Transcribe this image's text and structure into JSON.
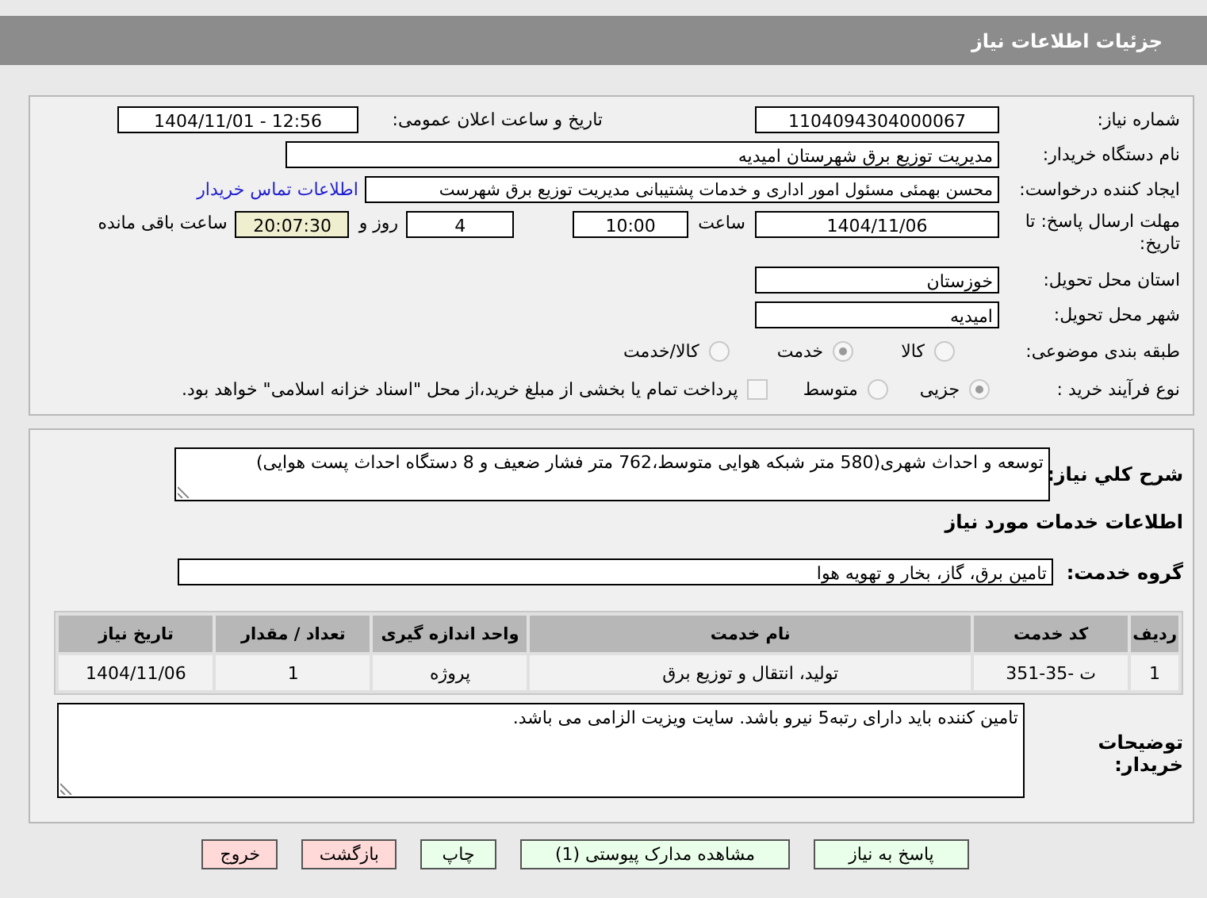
{
  "header": {
    "title": "جزئیات اطلاعات نیاز"
  },
  "need_number": {
    "label": "شماره نیاز:",
    "value": "1104094304000067"
  },
  "announce": {
    "label": "تاریخ و ساعت اعلان عمومی:",
    "value": "1404/11/01 - 12:56"
  },
  "buyer_name": {
    "label": "نام دستگاه خریدار:",
    "value": "مدیریت توزیع برق شهرستان امیدیه"
  },
  "creator": {
    "label": "ایجاد کننده درخواست:",
    "value": "محسن بهمئی مسئول امور اداری و خدمات پشتیبانی مدیریت توزیع برق شهرست",
    "link": "اطلاعات تماس خریدار"
  },
  "deadline": {
    "label": "مهلت ارسال پاسخ: تا تاریخ:",
    "date": "1404/11/06",
    "time_label": "ساعت",
    "time": "10:00",
    "days": "4",
    "days_label": "روز و",
    "remaining": "20:07:30",
    "remaining_label": "ساعت باقی مانده"
  },
  "province": {
    "label": "استان محل تحویل:",
    "value": "خوزستان"
  },
  "city": {
    "label": "شهر محل تحویل:",
    "value": "امیدیه"
  },
  "category": {
    "label": "طبقه بندی موضوعی:",
    "options": [
      {
        "label": "کالا",
        "selected": false
      },
      {
        "label": "خدمت",
        "selected": true
      },
      {
        "label": "کالا/خدمت",
        "selected": false
      }
    ]
  },
  "purchase_type": {
    "label": "نوع فرآیند خرید :",
    "options": [
      {
        "label": "جزیی",
        "selected": true
      },
      {
        "label": "متوسط",
        "selected": false
      }
    ],
    "treasury": {
      "label": "پرداخت تمام یا بخشی از مبلغ خرید،از محل \"اسناد خزانه اسلامی\" خواهد بود.",
      "checked": false
    }
  },
  "description": {
    "label": "شرح کلي نياز:",
    "value": "توسعه و احداث شهری(580 متر شبکه هوایی متوسط،762 متر فشار ضعیف و 8 دستگاه احداث پست هوایی)"
  },
  "services_title": "اطلاعات خدمات مورد نياز",
  "service_group": {
    "label": "گروه خدمت:",
    "value": "تامین برق، گاز، بخار و تهویه هوا"
  },
  "table": {
    "columns": [
      "ردیف",
      "کد خدمت",
      "نام خدمت",
      "واحد اندازه گیری",
      "تعداد / مقدار",
      "تاریخ نیاز"
    ],
    "rows": [
      [
        "1",
        "ت -35-351",
        "تولید، انتقال و توزیع برق",
        "پروژه",
        "1",
        "1404/11/06"
      ]
    ]
  },
  "buyer_notes": {
    "label": "توضیحات خریدار:",
    "value": "تامین کننده باید دارای رتبه5 نیرو باشد. سایت ویزیت الزامی می باشد."
  },
  "buttons": [
    {
      "label": "پاسخ به نیاز",
      "kind": "action"
    },
    {
      "label": "مشاهده مدارک پیوستی (1)",
      "kind": "action"
    },
    {
      "label": "چاپ",
      "kind": "action"
    },
    {
      "label": "بازگشت",
      "kind": "exit"
    },
    {
      "label": "خروج",
      "kind": "exit"
    }
  ]
}
